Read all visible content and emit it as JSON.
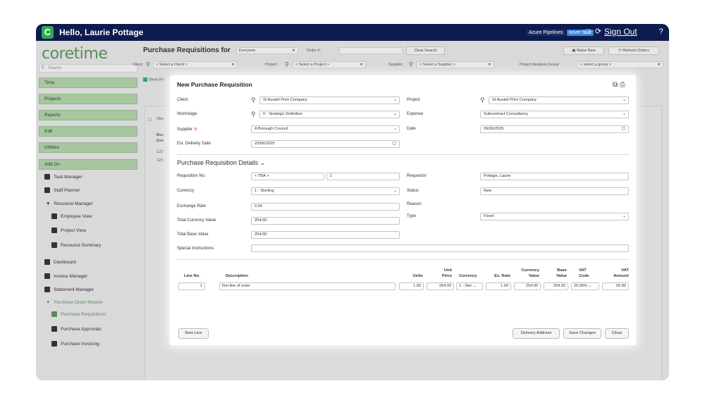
{
  "topbar": {
    "greeting": "Hello, Laurie Pottage",
    "logo_letter": "C",
    "azure_label": "Azure Pipelines",
    "azure_status": "never built",
    "signout": "Sign Out"
  },
  "sidebar": {
    "brand": "coretime",
    "search_placeholder": "Search",
    "buttons": [
      "Time",
      "Projects",
      "Reports",
      "Edit",
      "Utilities",
      "Add On"
    ],
    "items": [
      {
        "label": "Task Manager"
      },
      {
        "label": "Staff Planner"
      },
      {
        "label": "Resource Manager"
      },
      {
        "label": "Employee View"
      },
      {
        "label": "Project View"
      },
      {
        "label": "Resource Summary"
      },
      {
        "label": "Dashboard"
      },
      {
        "label": "Invoice Manager"
      },
      {
        "label": "Statement Manager"
      },
      {
        "label": "Purchase Order Module"
      },
      {
        "label": "Purchase Requisitions"
      },
      {
        "label": "Purchase Approvals"
      },
      {
        "label": "Purchase Invoicing"
      }
    ]
  },
  "main": {
    "title": "Purchase Requisitions for",
    "for_value": "Everyone",
    "order_label": "Order #:",
    "clear_search": "Clear Search",
    "raise_new": "Raise New",
    "refresh_orders": "Refresh Orders",
    "client_label": "Client",
    "client_value": "< Select a Client >",
    "project_label": "Project",
    "project_value": "< Select a Project >",
    "supplier_label": "Supplier",
    "supplier_value": "< Select a Supplier >",
    "pag_label": "Project Analysis Group",
    "pag_value": "< select a group >",
    "show_label": "Show Re",
    "bg_text_1": "Obs",
    "bg_text_2": "Rec",
    "bg_text_3": "(rev",
    "bg_text_4": "123",
    "bg_text_5": "123"
  },
  "modal": {
    "title": "New Purchase Requisition",
    "client_label": "Client",
    "client_value": "St Austell Print Company",
    "project_label": "Project",
    "project_value": "St Austell Print Company",
    "workstage_label": "Workstage",
    "workstage_value": "0 - Strategic Definition",
    "expense_label": "Expense",
    "expense_value": "Subcontract Consultancy",
    "supplier_label": "Supplier",
    "supplier_value": "A Borough Council",
    "date_label": "Date",
    "date_value": "09/06/2025",
    "delivery_label": "Est. Delivery Date",
    "delivery_value": "23/06/2025",
    "details_title": "Purchase Requisition Details",
    "req_no_label": "Requisition No.",
    "req_no_value": "< TBA >",
    "req_no_suffix": "1",
    "requestor_label": "Requestor",
    "requestor_value": "Pottage, Laurie",
    "currency_label": "Currency",
    "currency_value": "1 - Sterling",
    "status_label": "Status",
    "status_value": "New",
    "exrate_label": "Exchange Rate",
    "exrate_value": "0.00",
    "reason_label": "Reason",
    "tcv_label": "Total Currency Value",
    "tcv_value": "254.00",
    "type_label": "Type",
    "type_value": "Fixed",
    "tbv_label": "Total Base Value",
    "tbv_value": "254.00",
    "special_label": "Special Instructions",
    "special_value": "",
    "table": {
      "headers": {
        "line_no": "Line No.",
        "description": "Description",
        "units": "Units",
        "unit_price_1": "Unit",
        "unit_price_2": "Price",
        "currency": "Currency",
        "ex_rate": "Ex. Rate",
        "currency_value_1": "Currency",
        "currency_value_2": "Value",
        "base_value_1": "Base",
        "base_value_2": "Value",
        "vat_code_1": "VAT",
        "vat_code_2": "Code",
        "vat_amount_1": "VAT",
        "vat_amount_2": "Amount"
      },
      "row": {
        "line_no": "1",
        "description": "first line of order",
        "units": "1.00",
        "unit_price": "254.00",
        "currency": "1 - Ster",
        "ex_rate": "1.00",
        "currency_value": "254.00",
        "base_value": "254.00",
        "vat_code": "20.00%",
        "vat_amount": "50.80"
      }
    },
    "buttons": {
      "new_line": "New Line",
      "delivery_address": "Delivery Address",
      "save_changes": "Save Changes",
      "close": "Close"
    }
  },
  "colors": {
    "topbar": "#0d1b4e",
    "nav_green": "#a6c7a0",
    "brand_green": "#5a8c5a",
    "supplier_warning": "#e53935"
  }
}
